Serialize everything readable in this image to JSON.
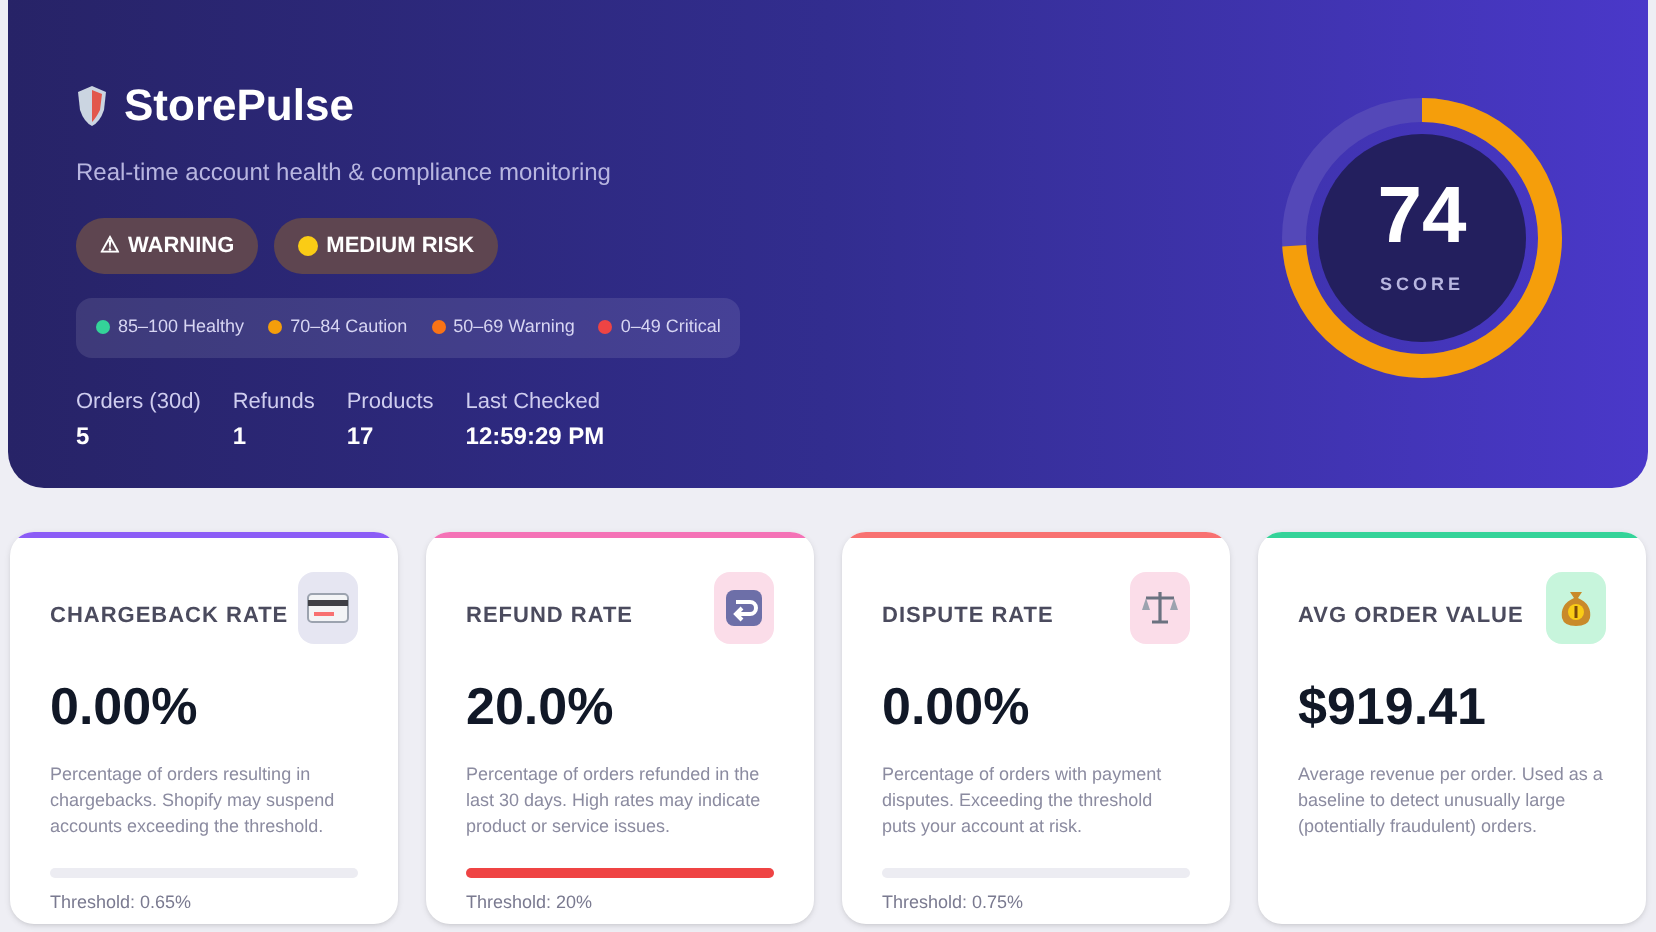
{
  "header": {
    "title": "StorePulse",
    "subtitle": "Real-time account health & compliance monitoring",
    "badges": [
      {
        "kind": "symbol",
        "symbol": "⚠",
        "label": "WARNING"
      },
      {
        "kind": "dot",
        "color": "#facc15",
        "label": "MEDIUM RISK"
      }
    ],
    "legend": [
      {
        "label": "85–100 Healthy",
        "color": "#34d399"
      },
      {
        "label": "70–84 Caution",
        "color": "#f59e0b"
      },
      {
        "label": "50–69 Warning",
        "color": "#f97316"
      },
      {
        "label": "0–49 Critical",
        "color": "#ef4444"
      }
    ],
    "stats": [
      {
        "label": "Orders (30d)",
        "value": "5"
      },
      {
        "label": "Refunds",
        "value": "1"
      },
      {
        "label": "Products",
        "value": "17"
      },
      {
        "label": "Last Checked",
        "value": "12:59:29 PM"
      }
    ],
    "score": {
      "value": "74",
      "label": "SCORE",
      "level": 0.74
    }
  },
  "metrics": [
    {
      "kind": "card",
      "title": "CHARGEBACK RATE",
      "value": "0.00%",
      "description": "Percentage of orders resulting in chargebacks. Shopify may suspend accounts exceeding the threshold.",
      "threshold": "Threshold: 0.65%",
      "level": 0,
      "color": "#8b5cf6"
    },
    {
      "kind": "return",
      "title": "REFUND RATE",
      "value": "20.0%",
      "description": "Percentage of orders refunded in the last 30 days. High rates may indicate product or service issues.",
      "threshold": "Threshold: 20%",
      "level": 1,
      "color": "#f472b6"
    },
    {
      "kind": "scales",
      "title": "DISPUTE RATE",
      "value": "0.00%",
      "description": "Percentage of orders with payment disputes. Exceeding the threshold puts your account at risk.",
      "threshold": "Threshold: 0.75%",
      "level": 0,
      "color": "#f87171"
    },
    {
      "kind": "bag",
      "title": "AVG ORDER VALUE",
      "value": "$919.41",
      "description": "Average revenue per order. Used as a baseline to detect unusually large (potentially fraudulent) orders.",
      "color": "#34d399"
    }
  ]
}
